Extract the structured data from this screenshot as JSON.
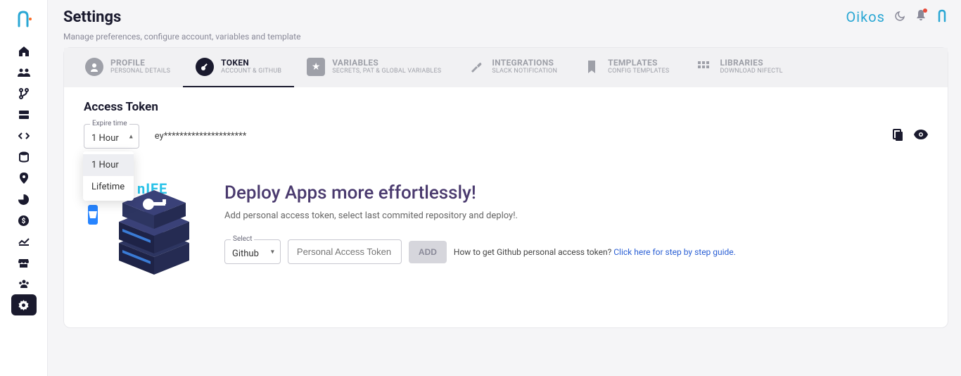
{
  "header": {
    "title": "Settings",
    "subtitle": "Manage preferences, configure account, variables and template",
    "org": "Oikos"
  },
  "tabs": [
    {
      "title": "PROFILE",
      "sub": "PERSONAL DETAILS"
    },
    {
      "title": "TOKEN",
      "sub": "ACCOUNT & GITHUB"
    },
    {
      "title": "VARIABLES",
      "sub": "SECRETS, PAT & GLOBAL VARIABLES"
    },
    {
      "title": "INTEGRATIONS",
      "sub": "SLACK NOTIFICATION"
    },
    {
      "title": "TEMPLATES",
      "sub": "CONFIG TEMPLATES"
    },
    {
      "title": "LIBRARIES",
      "sub": "DOWNLOAD NIFECTL"
    }
  ],
  "access_token": {
    "section_title": "Access Token",
    "expire_label": "Expire time",
    "expire_value": "1 Hour",
    "options": [
      "1 Hour",
      "Lifetime"
    ],
    "token_masked": "ey*********************"
  },
  "deploy": {
    "title": "Deploy Apps more effortlessly!",
    "subtitle": "Add personal access token, select last commited repository and deploy!.",
    "nife_logo": "nIFE",
    "select_label": "Select",
    "select_value": "Github",
    "pat_placeholder": "Personal Access Token",
    "add_button": "ADD",
    "help_prefix": "How to get Github personal access token? ",
    "help_link": "Click here for step by step guide."
  }
}
